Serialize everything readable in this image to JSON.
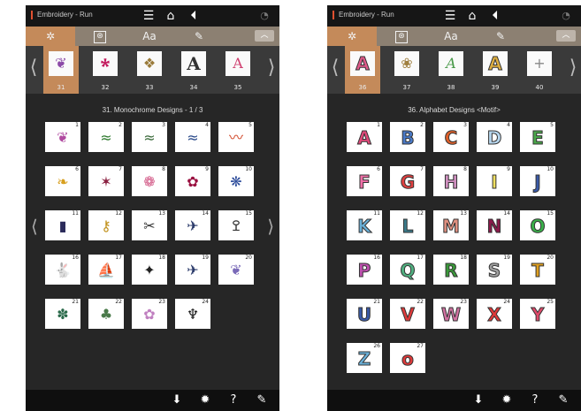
{
  "panels": [
    {
      "id": "left",
      "status": {
        "title": "Embroidery - Run"
      },
      "tabs": {
        "t1": "✲",
        "t2": "⊛",
        "t3": "Aa",
        "t4": "✎",
        "collapse": "︿"
      },
      "carousel": {
        "items": [
          {
            "num": "31",
            "glyph": "❦",
            "color": "#8c4aa8",
            "selected": true
          },
          {
            "num": "32",
            "glyph": "🞲",
            "color": "#c2185b",
            "selected": false
          },
          {
            "num": "33",
            "glyph": "❖",
            "color": "#9a7b3a",
            "selected": false
          },
          {
            "num": "34",
            "glyph": "A",
            "color": "#333333",
            "selected": false
          },
          {
            "num": "35",
            "glyph": "A",
            "color": "#d04070",
            "selected": false
          }
        ]
      },
      "title": "31. Monochrome Designs - 1 / 3",
      "cells": [
        {
          "num": "1",
          "glyph": "❦",
          "color": "#b04aa0"
        },
        {
          "num": "2",
          "glyph": "≈",
          "color": "#2e7a2e"
        },
        {
          "num": "3",
          "glyph": "≈",
          "color": "#3a6a3a"
        },
        {
          "num": "4",
          "glyph": "≈",
          "color": "#2a4a8a"
        },
        {
          "num": "5",
          "glyph": "〰",
          "color": "#d04020"
        },
        {
          "num": "6",
          "glyph": "❧",
          "color": "#d8a020"
        },
        {
          "num": "7",
          "glyph": "✶",
          "color": "#8a2040"
        },
        {
          "num": "8",
          "glyph": "❁",
          "color": "#d05080"
        },
        {
          "num": "9",
          "glyph": "✿",
          "color": "#9a1040"
        },
        {
          "num": "10",
          "glyph": "❋",
          "color": "#2a4a9a"
        },
        {
          "num": "11",
          "glyph": "▮",
          "color": "#2a2a5a"
        },
        {
          "num": "12",
          "glyph": "⚷",
          "color": "#c0901a"
        },
        {
          "num": "13",
          "glyph": "✂",
          "color": "#333333"
        },
        {
          "num": "14",
          "glyph": "✈",
          "color": "#2a3a6a"
        },
        {
          "num": "15",
          "glyph": "ߐ",
          "color": "#333333"
        },
        {
          "num": "16",
          "glyph": "🐇",
          "color": "#2a3a6a"
        },
        {
          "num": "17",
          "glyph": "⛵",
          "color": "#2a3a6a"
        },
        {
          "num": "18",
          "glyph": "✦",
          "color": "#222222"
        },
        {
          "num": "19",
          "glyph": "✈",
          "color": "#2a3a6a"
        },
        {
          "num": "20",
          "glyph": "❦",
          "color": "#7a6ab8"
        },
        {
          "num": "21",
          "glyph": "✽",
          "color": "#2a6a4a"
        },
        {
          "num": "22",
          "glyph": "♣",
          "color": "#4a7a4a"
        },
        {
          "num": "23",
          "glyph": "✿",
          "color": "#c080c0"
        },
        {
          "num": "24",
          "glyph": "♆",
          "color": "#111111"
        }
      ]
    },
    {
      "id": "right",
      "status": {
        "title": "Embroidery - Run"
      },
      "tabs": {
        "t1": "✲",
        "t2": "⊛",
        "t3": "Aa",
        "t4": "✎",
        "collapse": "︿"
      },
      "carousel": {
        "items": [
          {
            "num": "36",
            "glyph": "A",
            "color": "#e05a8a",
            "selected": true
          },
          {
            "num": "37",
            "glyph": "❀",
            "color": "#a08040",
            "selected": false
          },
          {
            "num": "38",
            "glyph": "A",
            "color": "#4a9a4a",
            "selected": false
          },
          {
            "num": "39",
            "glyph": "A",
            "color": "#e0b040",
            "selected": false
          },
          {
            "num": "40",
            "glyph": "+",
            "color": "#888888",
            "selected": false
          }
        ]
      },
      "title": "36. Alphabet Designs <Motif>",
      "cells": [
        {
          "num": "1",
          "glyph": "A",
          "color": "#e24a7a"
        },
        {
          "num": "2",
          "glyph": "B",
          "color": "#4a7ac8"
        },
        {
          "num": "3",
          "glyph": "C",
          "color": "#e0602a"
        },
        {
          "num": "4",
          "glyph": "D",
          "color": "#b8d8f0"
        },
        {
          "num": "5",
          "glyph": "E",
          "color": "#4aa84a"
        },
        {
          "num": "6",
          "glyph": "F",
          "color": "#f070a8"
        },
        {
          "num": "7",
          "glyph": "G",
          "color": "#e04040"
        },
        {
          "num": "8",
          "glyph": "H",
          "color": "#d090c0"
        },
        {
          "num": "9",
          "glyph": "I",
          "color": "#f0e060"
        },
        {
          "num": "10",
          "glyph": "J",
          "color": "#3a5aa8"
        },
        {
          "num": "11",
          "glyph": "K",
          "color": "#6ab0d8"
        },
        {
          "num": "12",
          "glyph": "L",
          "color": "#3a7a8a"
        },
        {
          "num": "13",
          "glyph": "M",
          "color": "#e09080"
        },
        {
          "num": "14",
          "glyph": "N",
          "color": "#8a1a4a"
        },
        {
          "num": "15",
          "glyph": "O",
          "color": "#3ab04a"
        },
        {
          "num": "16",
          "glyph": "P",
          "color": "#c050b0"
        },
        {
          "num": "17",
          "glyph": "Q",
          "color": "#50b080"
        },
        {
          "num": "18",
          "glyph": "R",
          "color": "#3a9a3a"
        },
        {
          "num": "19",
          "glyph": "S",
          "color": "#a0a0a0"
        },
        {
          "num": "20",
          "glyph": "T",
          "color": "#e0a020"
        },
        {
          "num": "21",
          "glyph": "U",
          "color": "#3a5aa8"
        },
        {
          "num": "22",
          "glyph": "V",
          "color": "#e03a3a"
        },
        {
          "num": "23",
          "glyph": "W",
          "color": "#d070a0"
        },
        {
          "num": "24",
          "glyph": "X",
          "color": "#e03a3a"
        },
        {
          "num": "25",
          "glyph": "Y",
          "color": "#e04a6a"
        },
        {
          "num": "26",
          "glyph": "Z",
          "color": "#6ab0d8"
        },
        {
          "num": "27",
          "glyph": "o",
          "color": "#e03a3a"
        }
      ]
    }
  ],
  "icons": {
    "menu": "☰",
    "home": "⌂",
    "back": "⏴",
    "wifi": "◔",
    "arrow_left": "⟨",
    "arrow_right": "⟩",
    "import": "⬇",
    "settings": "✹",
    "help": "?",
    "tools": "✎"
  }
}
